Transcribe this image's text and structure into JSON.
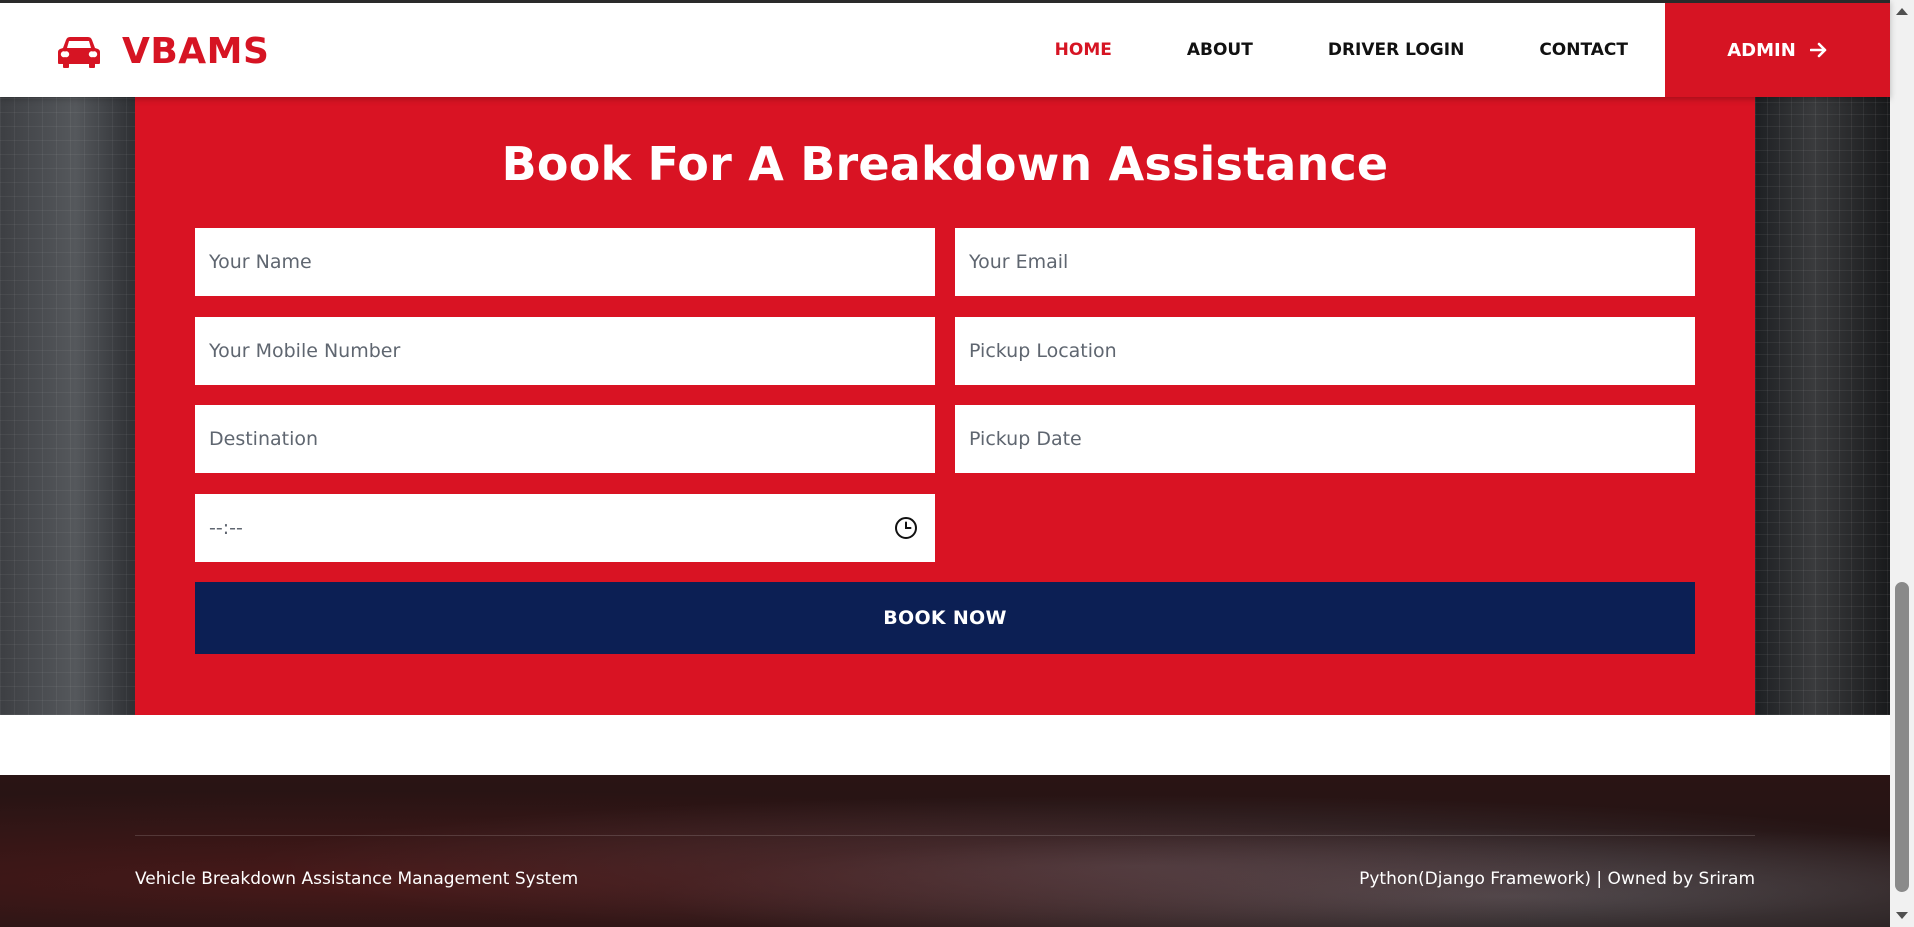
{
  "brand": {
    "name": "VBAMS",
    "icon": "car-icon"
  },
  "nav": {
    "items": [
      {
        "label": "HOME",
        "active": true
      },
      {
        "label": "ABOUT",
        "active": false
      },
      {
        "label": "DRIVER LOGIN",
        "active": false
      },
      {
        "label": "CONTACT",
        "active": false
      }
    ],
    "admin_label": "ADMIN",
    "admin_icon": "arrow-right-icon"
  },
  "booking": {
    "title": "Book For A Breakdown Assistance",
    "fields": {
      "name": {
        "placeholder": "Your Name",
        "value": ""
      },
      "email": {
        "placeholder": "Your Email",
        "value": ""
      },
      "mobile": {
        "placeholder": "Your Mobile Number",
        "value": ""
      },
      "pickup_location": {
        "placeholder": "Pickup Location",
        "value": ""
      },
      "destination": {
        "placeholder": "Destination",
        "value": ""
      },
      "pickup_date": {
        "placeholder": "Pickup Date",
        "value": ""
      },
      "time": {
        "display": "--:--",
        "icon": "clock-icon"
      }
    },
    "submit_label": "BOOK NOW"
  },
  "footer": {
    "left_text": "Vehicle Breakdown Assistance Management System",
    "right_text": "Python(Django Framework) | Owned by Sriram"
  },
  "colors": {
    "brand_red": "#d61423",
    "panel_red": "#d91323",
    "navy": "#0c1f54"
  }
}
